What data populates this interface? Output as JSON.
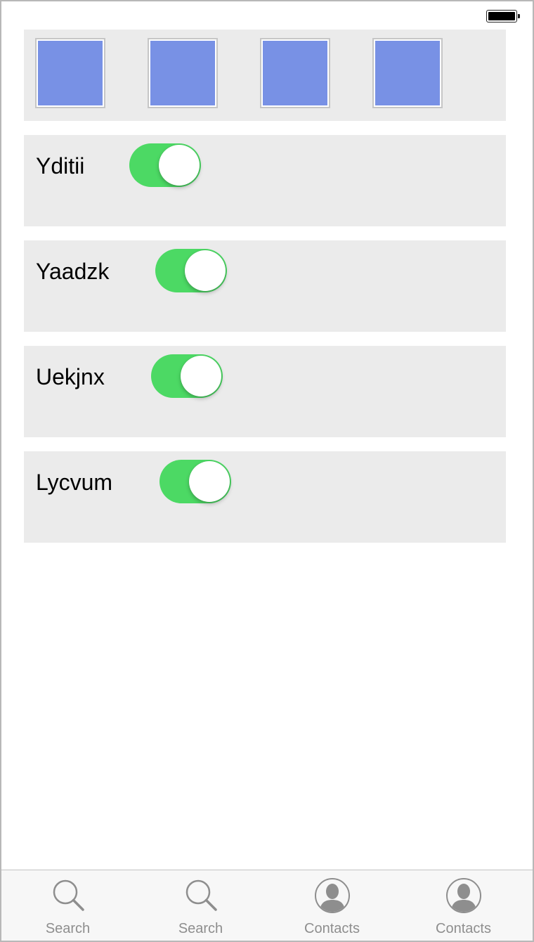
{
  "status_bar": {
    "battery_icon": "battery-full-icon",
    "battery_level": 1.0
  },
  "thumbnails": {
    "count": 4,
    "color": "#7891e5"
  },
  "rows": [
    {
      "label": "Yditii",
      "toggle_on": true
    },
    {
      "label": "Yaadzk",
      "toggle_on": true
    },
    {
      "label": "Uekjnx",
      "toggle_on": true
    },
    {
      "label": "Lycvum",
      "toggle_on": true
    }
  ],
  "colors": {
    "toggle_on": "#4cd964",
    "row_background": "#ebebeb",
    "tab_label": "#8e8e8e"
  },
  "tabbar": {
    "tabs": [
      {
        "label": "Search",
        "icon": "search-icon"
      },
      {
        "label": "Search",
        "icon": "search-icon"
      },
      {
        "label": "Contacts",
        "icon": "contact-icon"
      },
      {
        "label": "Contacts",
        "icon": "contact-icon"
      }
    ]
  }
}
